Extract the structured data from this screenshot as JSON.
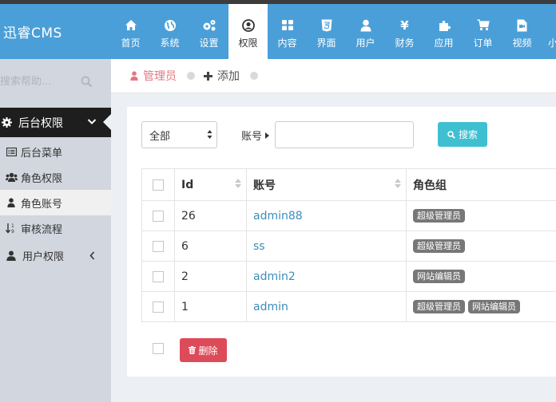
{
  "app": {
    "logo": "迅睿CMS"
  },
  "nav": [
    {
      "label": "首页",
      "icon": "home-icon"
    },
    {
      "label": "系统",
      "icon": "globe-icon"
    },
    {
      "label": "设置",
      "icon": "gears-icon"
    },
    {
      "label": "权限",
      "icon": "user-circle-icon",
      "active": true
    },
    {
      "label": "内容",
      "icon": "grid-icon"
    },
    {
      "label": "界面",
      "icon": "html5-icon"
    },
    {
      "label": "用户",
      "icon": "user-icon"
    },
    {
      "label": "财务",
      "icon": "yen-icon",
      "glyph": "¥"
    },
    {
      "label": "应用",
      "icon": "puzzle-icon"
    },
    {
      "label": "订单",
      "icon": "cart-icon"
    },
    {
      "label": "视频",
      "icon": "video-file-icon"
    },
    {
      "label": "小",
      "icon": "more-icon"
    }
  ],
  "sidebar": {
    "search_placeholder": "搜索帮助...",
    "section": "后台权限",
    "items": [
      {
        "label": "后台菜单",
        "icon": "list-icon"
      },
      {
        "label": "角色权限",
        "icon": "users-icon"
      },
      {
        "label": "角色账号",
        "icon": "user-icon",
        "active": true
      },
      {
        "label": "审核流程",
        "icon": "sort-numeric-icon"
      },
      {
        "label": "用户权限",
        "icon": "user-icon"
      }
    ]
  },
  "breadcrumb": {
    "current": "管理员",
    "add": "添加"
  },
  "filter": {
    "select_value": "全部",
    "account_label": "账号",
    "account_value": "",
    "search_button": "搜索"
  },
  "table": {
    "headers": {
      "id": "Id",
      "account": "账号",
      "role": "角色组"
    },
    "rows": [
      {
        "id": "26",
        "account": "admin88",
        "roles": [
          "超级管理员"
        ]
      },
      {
        "id": "6",
        "account": "ss",
        "roles": [
          "超级管理员"
        ]
      },
      {
        "id": "2",
        "account": "admin2",
        "roles": [
          "网站编辑员"
        ]
      },
      {
        "id": "1",
        "account": "admin",
        "roles": [
          "超级管理员",
          "网站编辑员"
        ]
      }
    ]
  },
  "actions": {
    "delete": "删除"
  },
  "colors": {
    "topbar": "#4a9fd8",
    "accent_red": "#dd4b59",
    "search_btn": "#3fc0d1",
    "link": "#3c8dbc",
    "badge": "#777777"
  }
}
